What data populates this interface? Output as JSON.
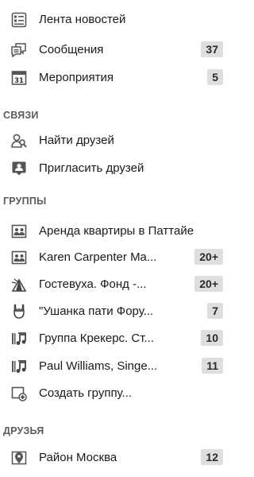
{
  "menu": {
    "top": [
      {
        "label": "Лента новостей",
        "icon": "news-feed-icon"
      },
      {
        "label": "Сообщения",
        "icon": "messages-icon",
        "badge": "37"
      },
      {
        "label": "Мероприятия",
        "icon": "calendar-icon",
        "icon_text": "31",
        "badge": "5"
      }
    ],
    "sections": {
      "connections": "СВЯЗИ",
      "groups": "ГРУППЫ",
      "friends": "ДРУЗЬЯ"
    },
    "connections": [
      {
        "label": "Найти друзей",
        "icon": "find-friends-icon"
      },
      {
        "label": "Пригласить друзей",
        "icon": "invite-friends-icon"
      }
    ],
    "groups": [
      {
        "label": "Аренда квартиры в Паттайе",
        "icon": "group-icon"
      },
      {
        "label": "Karen Carpenter Ma...",
        "icon": "group-icon",
        "badge": "20+"
      },
      {
        "label": "Гостевуха. Фонд -...",
        "icon": "camping-icon",
        "badge": "20+"
      },
      {
        "label": "\"Ушанка пати Фору...",
        "icon": "rock-hand-icon",
        "badge": "7"
      },
      {
        "label": "Группа Крекерс. Ст...",
        "icon": "music-icon",
        "badge": "10"
      },
      {
        "label": "Paul Williams, Singe...",
        "icon": "music-icon",
        "badge": "11"
      },
      {
        "label": "Создать группу...",
        "icon": "create-group-icon"
      }
    ],
    "friends": [
      {
        "label": "Район Москва",
        "icon": "location-icon",
        "badge": "12"
      }
    ]
  }
}
